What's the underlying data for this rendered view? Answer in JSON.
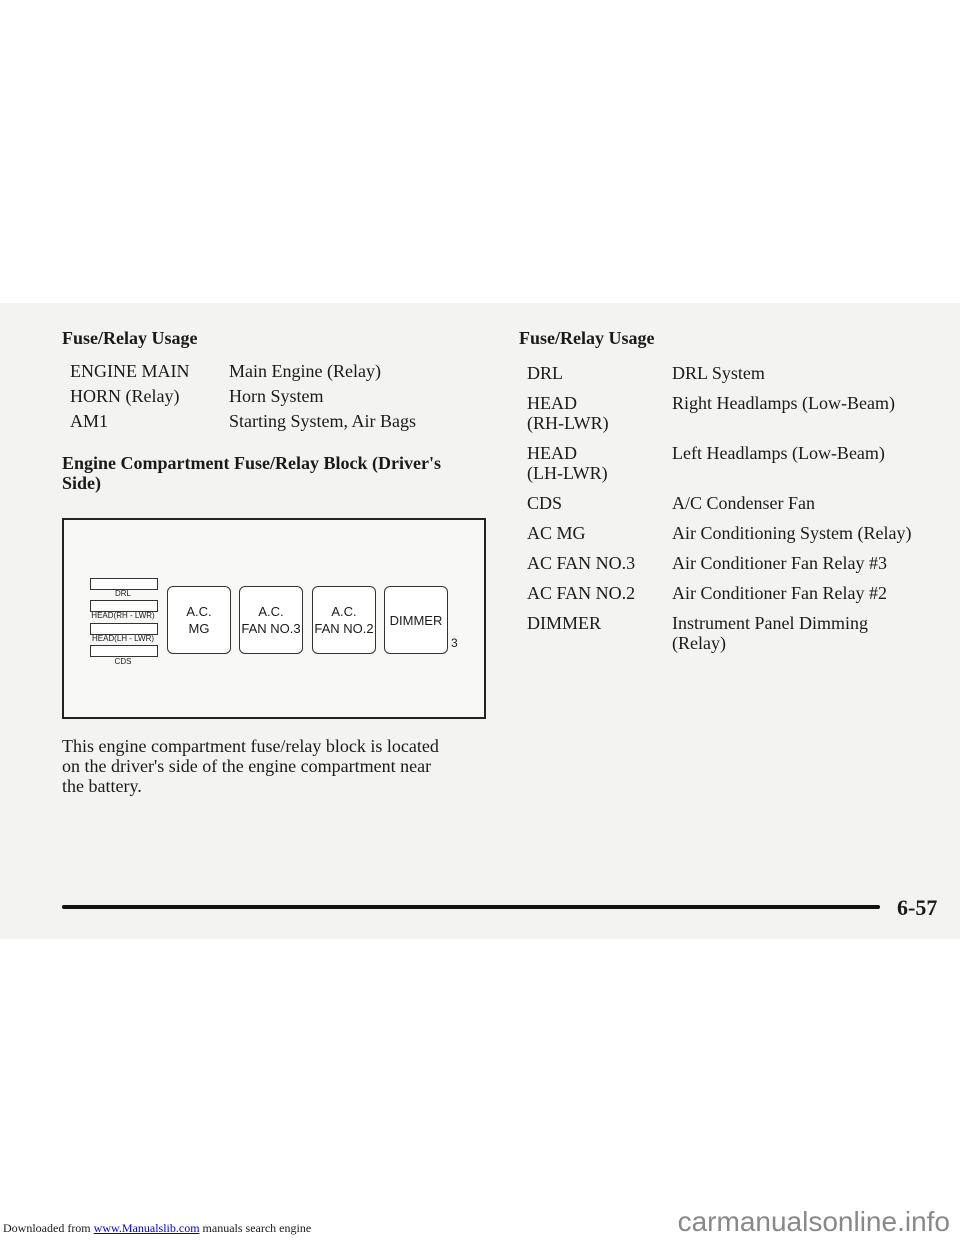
{
  "left": {
    "heading": "Fuse/Relay Usage",
    "rows": [
      [
        "ENGINE MAIN",
        "Main Engine (Relay)"
      ],
      [
        "HORN (Relay)",
        "Horn System"
      ],
      [
        "AM1",
        "Starting System, Air Bags"
      ]
    ],
    "subheading_1": "Engine Compartment Fuse/Relay Block (Driver's",
    "subheading_2": "Side)",
    "diagram": {
      "fuses": [
        "DRL",
        "HEAD(RH - LWR)",
        "HEAD(LH - LWR)",
        "CDS"
      ],
      "relays": [
        [
          "A.C.",
          "MG"
        ],
        [
          "A.C.",
          "FAN NO.3"
        ],
        [
          "A.C.",
          "FAN NO.2"
        ],
        [
          "DIMMER",
          ""
        ]
      ],
      "number": "3"
    },
    "para": [
      "This engine compartment fuse/relay block is located",
      "on the driver's side of the engine compartment near",
      "the battery."
    ]
  },
  "right": {
    "heading": "Fuse/Relay Usage",
    "rows": [
      {
        "name": [
          "DRL"
        ],
        "use": [
          "DRL System"
        ]
      },
      {
        "name": [
          "HEAD",
          "(RH-LWR)"
        ],
        "use": [
          "Right Headlamps (Low-Beam)"
        ]
      },
      {
        "name": [
          "HEAD",
          "(LH-LWR)"
        ],
        "use": [
          "Left Headlamps (Low-Beam)"
        ]
      },
      {
        "name": [
          "CDS"
        ],
        "use": [
          "A/C Condenser Fan"
        ]
      },
      {
        "name": [
          "AC MG"
        ],
        "use": [
          "Air Conditioning System (Relay)"
        ]
      },
      {
        "name": [
          "AC FAN NO.3"
        ],
        "use": [
          "Air Conditioner Fan Relay #3"
        ]
      },
      {
        "name": [
          "AC FAN NO.2"
        ],
        "use": [
          "Air Conditioner Fan Relay #2"
        ]
      },
      {
        "name": [
          "DIMMER"
        ],
        "use": [
          "Instrument Panel Dimming",
          "(Relay)"
        ]
      }
    ]
  },
  "page_number": "6-57",
  "footer": {
    "prefix": "Downloaded from",
    "link": "www.Manualslib.com",
    "suffix": "manuals search engine",
    "watermark": "carmanualsonline.info"
  }
}
